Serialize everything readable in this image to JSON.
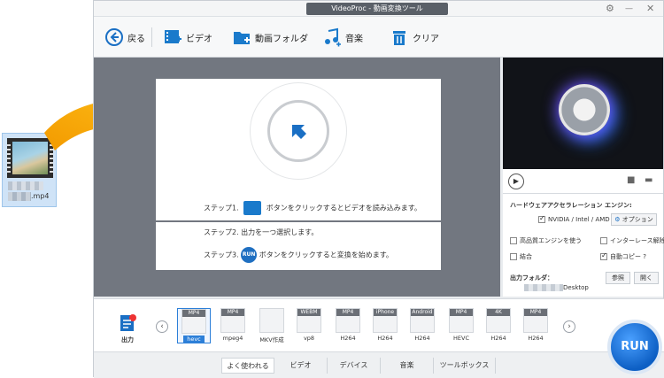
{
  "desktop_file": {
    "name": ".mp4"
  },
  "window": {
    "title": "VideoProc - 動画変換ツール",
    "controls": {
      "settings": "⚙",
      "minimize": "—",
      "close": "✕"
    }
  },
  "toolbar": {
    "back": "戻る",
    "video": "ビデオ",
    "folder": "動画フォルダ",
    "music": "音楽",
    "clear": "クリア"
  },
  "steps": {
    "step1_prefix": "ステップ1.",
    "step1_text": "ボタンをクリックするとビデオを読み込みます。",
    "step2": "ステップ2. 出力を一つ選択します。",
    "step3_prefix": "ステップ3.",
    "step3_text": "ボタンをクリックすると変換を始めます。",
    "run_small": "RUN"
  },
  "options": {
    "hw_title": "ハードウェアアクセラレーション エンジン:",
    "hw_vendor": "NVIDIA / Intel / AMD",
    "option_btn": "オプション",
    "hq_engine": "高品質エンジンを使う",
    "deinterlace": "インターレース解除",
    "merge": "結合",
    "autocopy": "自動コピー ?",
    "output_folder_label": "出力フォルダ：",
    "output_folder_path": "Desktop",
    "browse": "参照",
    "open": "開く"
  },
  "output": {
    "label": "出力"
  },
  "formats": [
    {
      "top": "MP4",
      "bottom": "hevc"
    },
    {
      "top": "MP4",
      "bottom": "mpeg4"
    },
    {
      "top": "",
      "bottom": "MKV作成"
    },
    {
      "top": "WEBM",
      "bottom": "vp8"
    },
    {
      "top": "MP4",
      "bottom": "H264"
    },
    {
      "top": "iPhone",
      "bottom": "H264"
    },
    {
      "top": "Android",
      "bottom": "H264"
    },
    {
      "top": "MP4",
      "bottom": "HEVC"
    },
    {
      "top": "4K",
      "bottom": "H264"
    },
    {
      "top": "MP4",
      "bottom": "H264"
    }
  ],
  "tabs": [
    "よく使われる",
    "ビデオ",
    "デバイス",
    "音楽",
    "ツールボックス"
  ],
  "run_label": "RUN",
  "colors": {
    "accent": "#1f6fc1",
    "arrow": "#f6a800",
    "stage": "#727780"
  }
}
